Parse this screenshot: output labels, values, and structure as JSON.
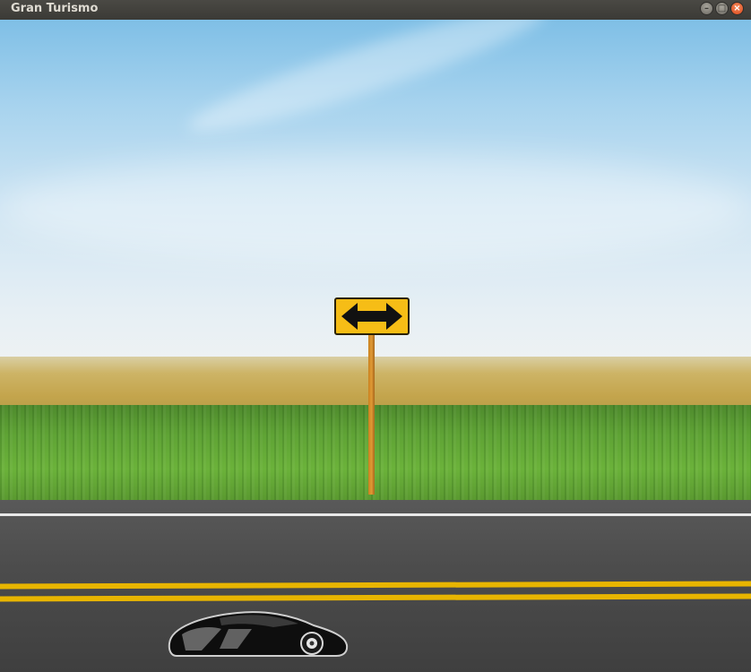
{
  "window": {
    "title": "Gran Turismo",
    "controls": {
      "minimize_icon": "minimize-icon",
      "maximize_icon": "maximize-icon",
      "close_icon": "close-icon"
    }
  },
  "scene": {
    "sign": {
      "icon": "double-arrow-icon",
      "color": "#f6bd16"
    },
    "player_car": {
      "icon": "car-icon",
      "color": "#111111"
    },
    "road_line_color": "#e8b500"
  }
}
